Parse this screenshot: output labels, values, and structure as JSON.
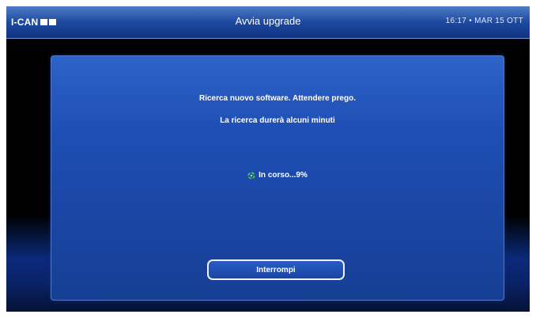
{
  "header": {
    "brand": "I-CAN",
    "title": "Avvia upgrade",
    "clock": "16:17 • MAR 15 OTT"
  },
  "dialog": {
    "message_line1": "Ricerca nuovo software. Attendere prego.",
    "message_line2": "La ricerca durerà alcuni minuti",
    "progress_text": "In corso...9%",
    "progress_percent": 9,
    "cancel_button": "Interrompi"
  },
  "colors": {
    "topbar": "#1d4aa0",
    "dialog_background": "#1e4fb4",
    "spinner": "#3fbf3f",
    "button_border": "#f2f2f2"
  },
  "icons": {
    "progress": "spinner-icon",
    "brand": "logo-squares"
  }
}
